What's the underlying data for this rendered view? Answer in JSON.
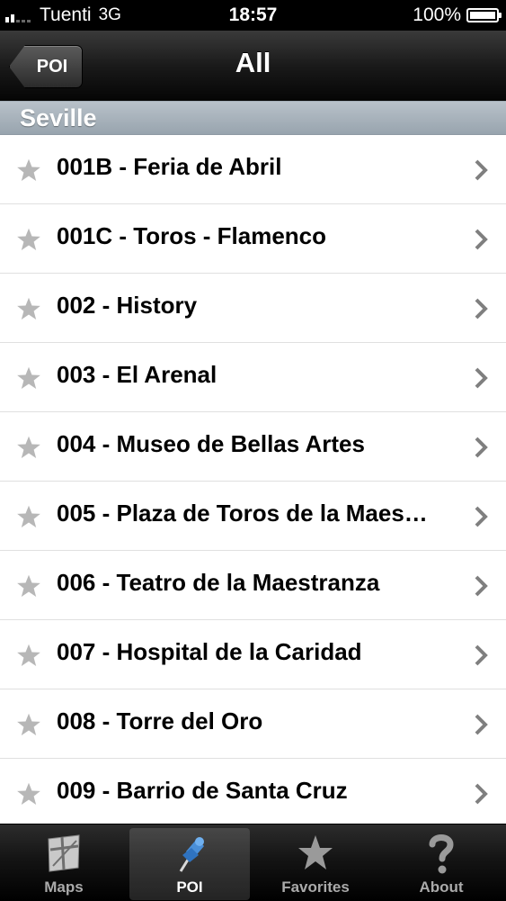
{
  "status": {
    "carrier": "Tuenti",
    "network": "3G",
    "time": "18:57",
    "battery": "100%"
  },
  "nav": {
    "back_label": "POI",
    "title": "All"
  },
  "section": {
    "title": "Seville"
  },
  "items": [
    {
      "label": "001B - Feria de Abril"
    },
    {
      "label": "001C - Toros - Flamenco"
    },
    {
      "label": "002 - History"
    },
    {
      "label": "003 - El Arenal"
    },
    {
      "label": "004 - Museo de Bellas Artes"
    },
    {
      "label": "005 - Plaza de Toros de la Maes…"
    },
    {
      "label": "006 - Teatro de la Maestranza"
    },
    {
      "label": "007 - Hospital de la Caridad"
    },
    {
      "label": "008 - Torre del Oro"
    },
    {
      "label": "009 - Barrio de Santa Cruz"
    }
  ],
  "tabs": [
    {
      "label": "Maps",
      "icon": "map-icon"
    },
    {
      "label": "POI",
      "icon": "pushpin-icon",
      "active": true
    },
    {
      "label": "Favorites",
      "icon": "star-icon"
    },
    {
      "label": "About",
      "icon": "question-icon"
    }
  ],
  "colors": {
    "star": "#b7b7b7",
    "chevron": "#7f7f7f",
    "tab_active_icon": "#4a8fd8"
  }
}
